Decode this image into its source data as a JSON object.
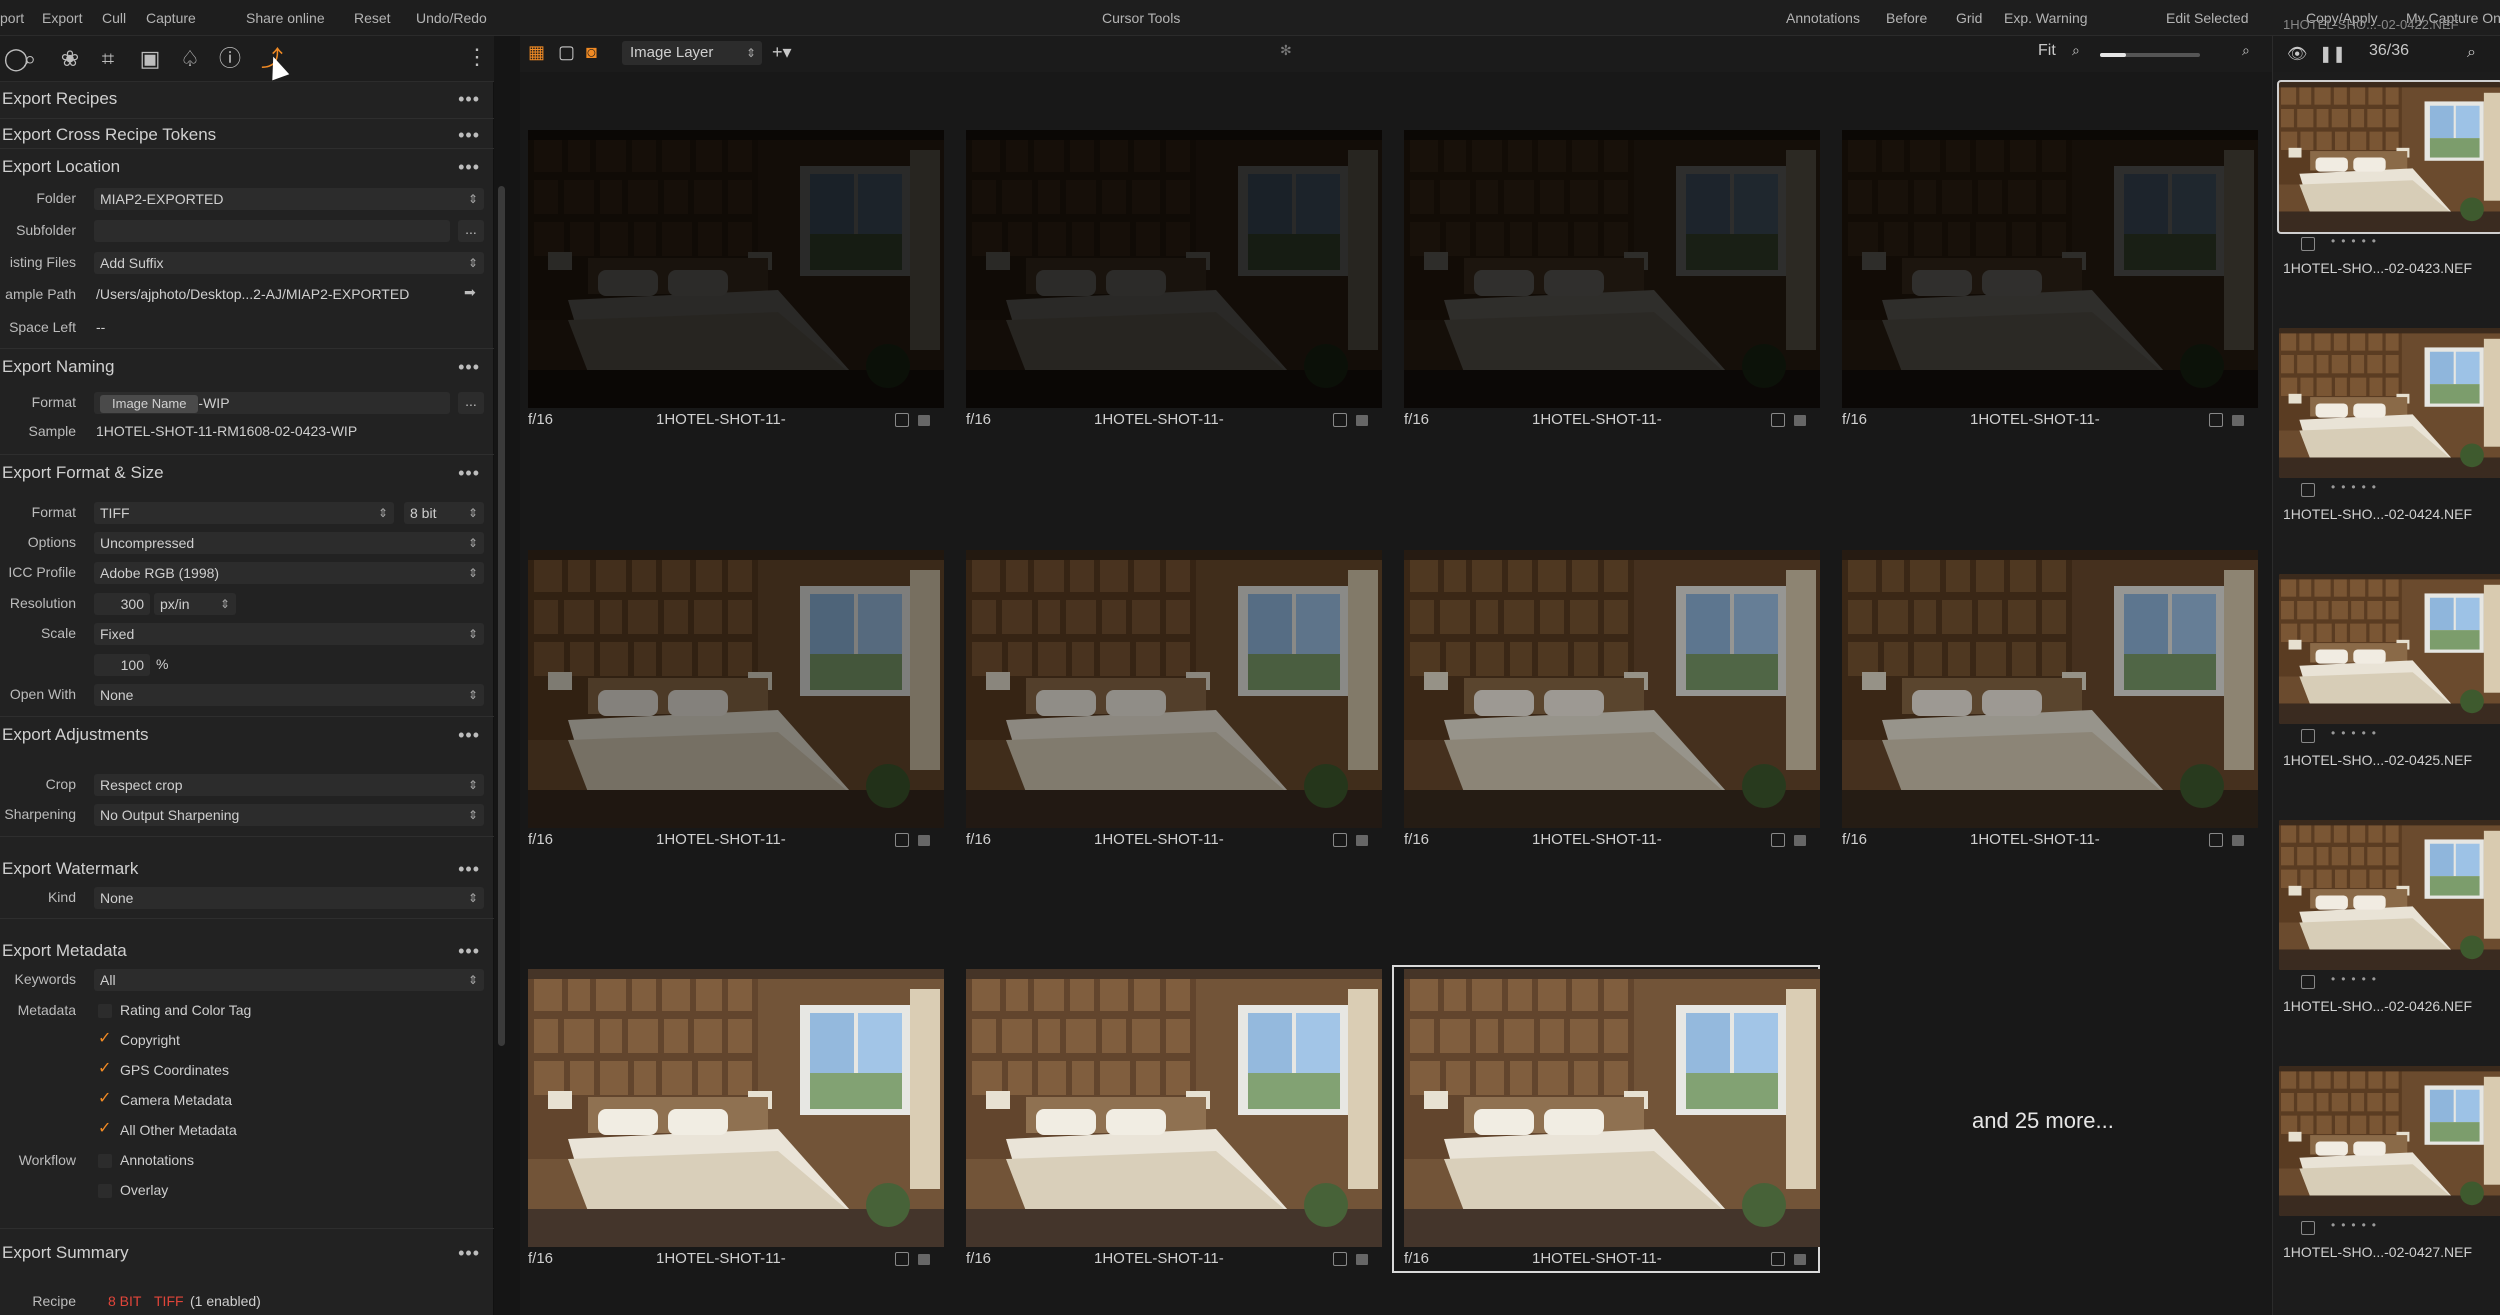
{
  "topbar": {
    "items": [
      "port",
      "Export",
      "Cull",
      "Capture",
      "Share online",
      "Reset",
      "Undo/Redo",
      "Cursor Tools",
      "Annotations",
      "Before",
      "Grid",
      "Exp. Warning",
      "Edit Selected",
      "Copy/Apply",
      "My Capture On"
    ]
  },
  "sections": {
    "recipes": "Export Recipes",
    "tokens": "Export Cross Recipe Tokens",
    "location": "Export Location",
    "naming": "Export Naming",
    "format_size": "Export Format & Size",
    "adjustments": "Export Adjustments",
    "watermark": "Export Watermark",
    "metadata": "Export Metadata",
    "summary": "Export Summary",
    "dots": "•••"
  },
  "location": {
    "folder_label": "Folder",
    "folder_value": "MIAP2-EXPORTED",
    "subfolder_label": "Subfolder",
    "subfolder_btn": "...",
    "existing_label": "isting Files",
    "existing_value": "Add Suffix",
    "sample_path_label": "ample Path",
    "sample_path_value": "/Users/ajphoto/Desktop...2-AJ/MIAP2-EXPORTED",
    "space_label": "Space Left",
    "space_value": "--"
  },
  "naming": {
    "format_label": "Format",
    "format_token": "Image Name",
    "format_suffix": "-WIP",
    "format_btn": "...",
    "sample_label": "Sample",
    "sample_value": "1HOTEL-SHOT-11-RM1608-02-0423-WIP"
  },
  "format_size": {
    "format_label": "Format",
    "format_value": "TIFF",
    "bit_value": "8 bit",
    "options_label": "Options",
    "options_value": "Uncompressed",
    "icc_label": "ICC Profile",
    "icc_value": "Adobe RGB (1998)",
    "resolution_label": "Resolution",
    "resolution_value": "300",
    "resolution_unit": "px/in",
    "scale_label": "Scale",
    "scale_value": "Fixed",
    "scale_percent": "100",
    "percent_sign": "%",
    "open_with_label": "Open With",
    "open_with_value": "None"
  },
  "adjustments": {
    "crop_label": "Crop",
    "crop_value": "Respect crop",
    "sharpening_label": "Sharpening",
    "sharpening_value": "No Output Sharpening"
  },
  "watermark": {
    "kind_label": "Kind",
    "kind_value": "None"
  },
  "metadata": {
    "keywords_label": "Keywords",
    "keywords_value": "All",
    "metadata_label": "Metadata",
    "items": [
      {
        "label": "Rating and Color Tag",
        "checked": false
      },
      {
        "label": "Copyright",
        "checked": true
      },
      {
        "label": "GPS Coordinates",
        "checked": true
      },
      {
        "label": "Camera Metadata",
        "checked": true
      },
      {
        "label": "All Other Metadata",
        "checked": true
      }
    ],
    "workflow_label": "Workflow",
    "workflow_items": [
      {
        "label": "Annotations",
        "checked": false
      },
      {
        "label": "Overlay",
        "checked": false
      }
    ]
  },
  "summary": {
    "recipe_label": "Recipe",
    "recipe_bit": "8 BIT",
    "recipe_format": "TIFF",
    "recipe_enabled": "(1 enabled)"
  },
  "viewer_toolbar": {
    "layer": "Image Layer",
    "fit": "Fit",
    "count": "36/36"
  },
  "grid": {
    "aperture": "f/16",
    "name": "1HOTEL-SHOT-11-",
    "more": "and 25 more..."
  },
  "filmstrip": {
    "top_name": "1HOTEL-SHO...-02-0422.NEF",
    "items": [
      "1HOTEL-SHO...-02-0423.NEF",
      "1HOTEL-SHO...-02-0424.NEF",
      "1HOTEL-SHO...-02-0425.NEF",
      "1HOTEL-SHO...-02-0426.NEF",
      "1HOTEL-SHO...-02-0427.NEF"
    ]
  },
  "colors": {
    "accent": "#f08a24",
    "summary_red": "#e0453a",
    "panel": "#222222",
    "grid_bg": "#181818"
  }
}
